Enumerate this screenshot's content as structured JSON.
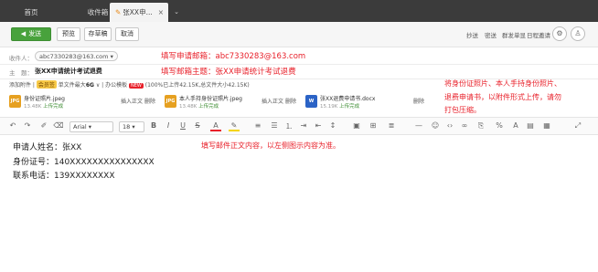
{
  "tabs": {
    "home": "首页",
    "inbox": "收件箱",
    "active": "张XX申...",
    "active_close": "×",
    "more": "⌄"
  },
  "toolbar": {
    "send": "发送",
    "preview": "预览",
    "draft": "存草稿",
    "cancel": "取消",
    "right_links": [
      "抄送",
      "密送",
      "群发单显",
      "日程邀请"
    ]
  },
  "recipient": {
    "label": "收件人：",
    "address": "abc7330283@163.com"
  },
  "subject": {
    "label": "主　题：",
    "value": "张XX申请统计考试退费"
  },
  "attachments_bar": {
    "add": "添加附件",
    "vip": "会员签",
    "max": "单文件最大",
    "max_value": "6G",
    "office": "办公模板",
    "new_badge": "NEW",
    "usage": "(100%已上传42.15K,总文件大小42.15K)"
  },
  "attachments": [
    {
      "name": "身份证照片.jpeg",
      "size": "13.48K",
      "status": "上传完成",
      "type": "JPG",
      "actions": [
        "插入正文",
        "删除"
      ]
    },
    {
      "name": "本人手持身份证照片.jpeg",
      "size": "13.48K",
      "status": "上传完成",
      "type": "JPG",
      "actions": [
        "插入正文",
        "删除"
      ]
    },
    {
      "name": "张XX退费申请书.docx",
      "size": "15.19K",
      "status": "上传完成",
      "type": "W",
      "actions": [
        "删除"
      ]
    }
  ],
  "editor": {
    "font": "Arial",
    "size": "18"
  },
  "body_lines": [
    "申请人姓名：张XX",
    "身份证号：140XXXXXXXXXXXXXXX",
    "联系电话：139XXXXXXXX"
  ],
  "annotations": {
    "recipient_note": "填写申请邮箱：abc7330283@163.com",
    "subject_note": "填写邮箱主题：张XX申请统计考试退费",
    "attach_note_1": "将身份证照片、本人手持身份照片、",
    "attach_note_2": "退费申请书，以附件形式上传，请勿",
    "attach_note_3": "打包压缩。",
    "body_note": "填写邮件正文内容，以左侧图示内容为准。"
  },
  "colors": {
    "annotation_red": "#e8202a",
    "send_green": "#48a23c",
    "tabbar_dark": "#3b3b3b"
  }
}
